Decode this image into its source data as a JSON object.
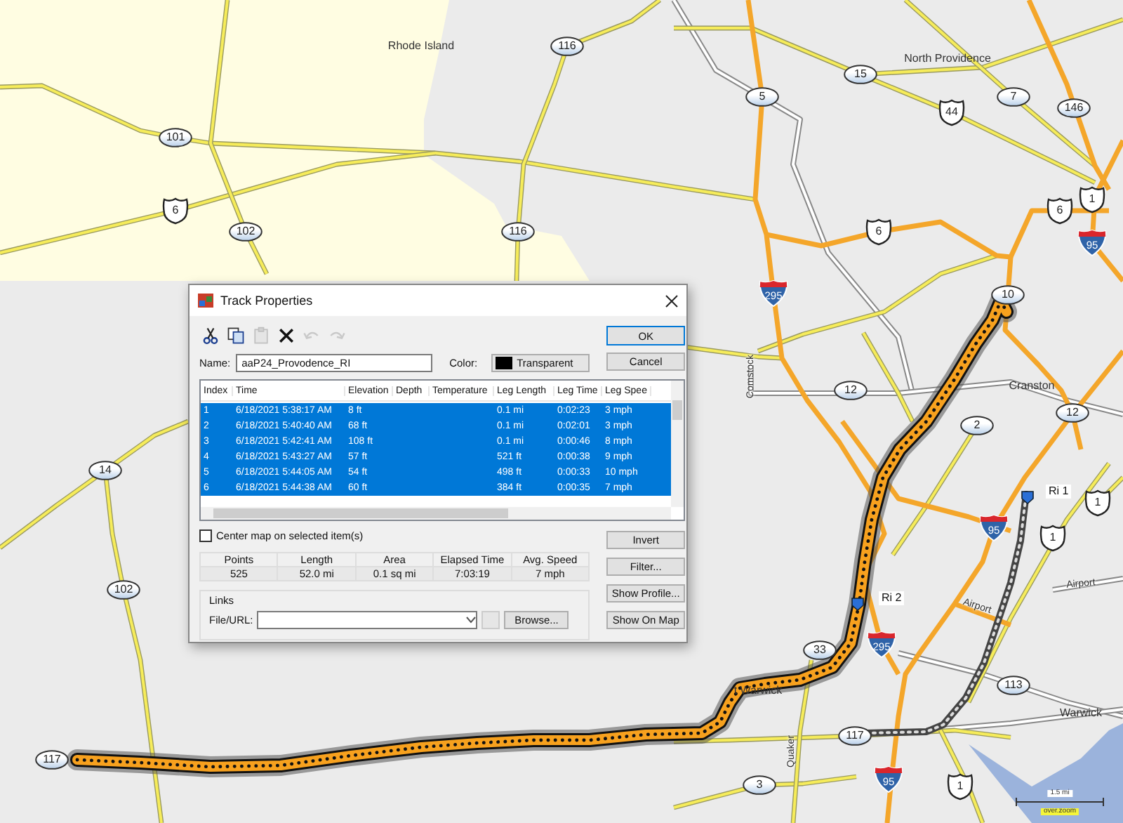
{
  "map": {
    "places": [
      "Rhode Island",
      "North Providence",
      "Cranston",
      "t Warwick",
      "Warwick"
    ],
    "road_labels": [
      "Comstock",
      "Quaker",
      "Airport",
      "Airport"
    ],
    "shields": [
      {
        "kind": "oval",
        "label": "116"
      },
      {
        "kind": "oval",
        "label": "15"
      },
      {
        "kind": "oval",
        "label": "5"
      },
      {
        "kind": "oval",
        "label": "7"
      },
      {
        "kind": "us",
        "label": "44"
      },
      {
        "kind": "oval",
        "label": "146"
      },
      {
        "kind": "oval",
        "label": "101"
      },
      {
        "kind": "us",
        "label": "6"
      },
      {
        "kind": "oval",
        "label": "102"
      },
      {
        "kind": "oval",
        "label": "116"
      },
      {
        "kind": "us",
        "label": "6"
      },
      {
        "kind": "us",
        "label": "6"
      },
      {
        "kind": "us",
        "label": "1"
      },
      {
        "kind": "interstate",
        "label": "95"
      },
      {
        "kind": "interstate",
        "label": "295"
      },
      {
        "kind": "oval",
        "label": "10"
      },
      {
        "kind": "oval",
        "label": "12"
      },
      {
        "kind": "oval",
        "label": "12"
      },
      {
        "kind": "oval",
        "label": "2"
      },
      {
        "kind": "oval",
        "label": "14"
      },
      {
        "kind": "us",
        "label": "1"
      },
      {
        "kind": "interstate",
        "label": "95"
      },
      {
        "kind": "us",
        "label": "1"
      },
      {
        "kind": "oval",
        "label": "102"
      },
      {
        "kind": "interstate",
        "label": "295"
      },
      {
        "kind": "oval",
        "label": "33"
      },
      {
        "kind": "oval",
        "label": "113"
      },
      {
        "kind": "oval",
        "label": "117"
      },
      {
        "kind": "oval",
        "label": "117"
      },
      {
        "kind": "oval",
        "label": "3"
      },
      {
        "kind": "interstate",
        "label": "95"
      },
      {
        "kind": "us",
        "label": "1"
      }
    ],
    "waypoints": [
      "Ri 1",
      "Ri 2"
    ],
    "scale": {
      "distance": "1.5 mi",
      "credit": "over.zoom"
    }
  },
  "dialog": {
    "title": "Track Properties",
    "toolbar": [
      {
        "kind": "cut",
        "disabled": false
      },
      {
        "kind": "copy",
        "disabled": false
      },
      {
        "kind": "paste",
        "disabled": true
      },
      {
        "kind": "delete",
        "disabled": false
      },
      {
        "kind": "undo",
        "disabled": true
      },
      {
        "kind": "redo",
        "disabled": true
      }
    ],
    "name_label": "Name:",
    "name_value": "aaP24_Provodence_RI",
    "color_label": "Color:",
    "color_value": "Transparent",
    "table": {
      "columns": [
        "Index",
        "Time",
        "Elevation",
        "Depth",
        "Temperature",
        "Leg Length",
        "Leg Time",
        "Leg Spee"
      ],
      "rows": [
        {
          "cells": [
            "1",
            "6/18/2021 5:38:17 AM",
            "8 ft",
            "",
            "",
            "0.1 mi",
            "0:02:23",
            "3 mph"
          ],
          "selected": true
        },
        {
          "cells": [
            "2",
            "6/18/2021 5:40:40 AM",
            "68 ft",
            "",
            "",
            "0.1 mi",
            "0:02:01",
            "3 mph"
          ],
          "selected": true
        },
        {
          "cells": [
            "3",
            "6/18/2021 5:42:41 AM",
            "108 ft",
            "",
            "",
            "0.1 mi",
            "0:00:46",
            "8 mph"
          ],
          "selected": true
        },
        {
          "cells": [
            "4",
            "6/18/2021 5:43:27 AM",
            "57 ft",
            "",
            "",
            "521 ft",
            "0:00:38",
            "9 mph"
          ],
          "selected": true
        },
        {
          "cells": [
            "5",
            "6/18/2021 5:44:05 AM",
            "54 ft",
            "",
            "",
            "498 ft",
            "0:00:33",
            "10 mph"
          ],
          "selected": true
        },
        {
          "cells": [
            "6",
            "6/18/2021 5:44:38 AM",
            "60 ft",
            "",
            "",
            "384 ft",
            "0:00:35",
            "7 mph"
          ],
          "selected": true
        }
      ]
    },
    "center_checkbox": {
      "label": "Center map on selected item(s)",
      "checked": false
    },
    "stats": [
      {
        "label": "Points",
        "value": "525"
      },
      {
        "label": "Length",
        "value": "52.0 mi"
      },
      {
        "label": "Area",
        "value": "0.1 sq mi"
      },
      {
        "label": "Elapsed Time",
        "value": "7:03:19"
      },
      {
        "label": "Avg. Speed",
        "value": "7 mph"
      }
    ],
    "links": {
      "title": "Links",
      "field_label": "File/URL:",
      "browse": "Browse..."
    },
    "buttons": [
      "OK",
      "Cancel"
    ],
    "side_buttons": [
      "Invert",
      "Filter...",
      "Show Profile...",
      "Show On Map"
    ]
  }
}
